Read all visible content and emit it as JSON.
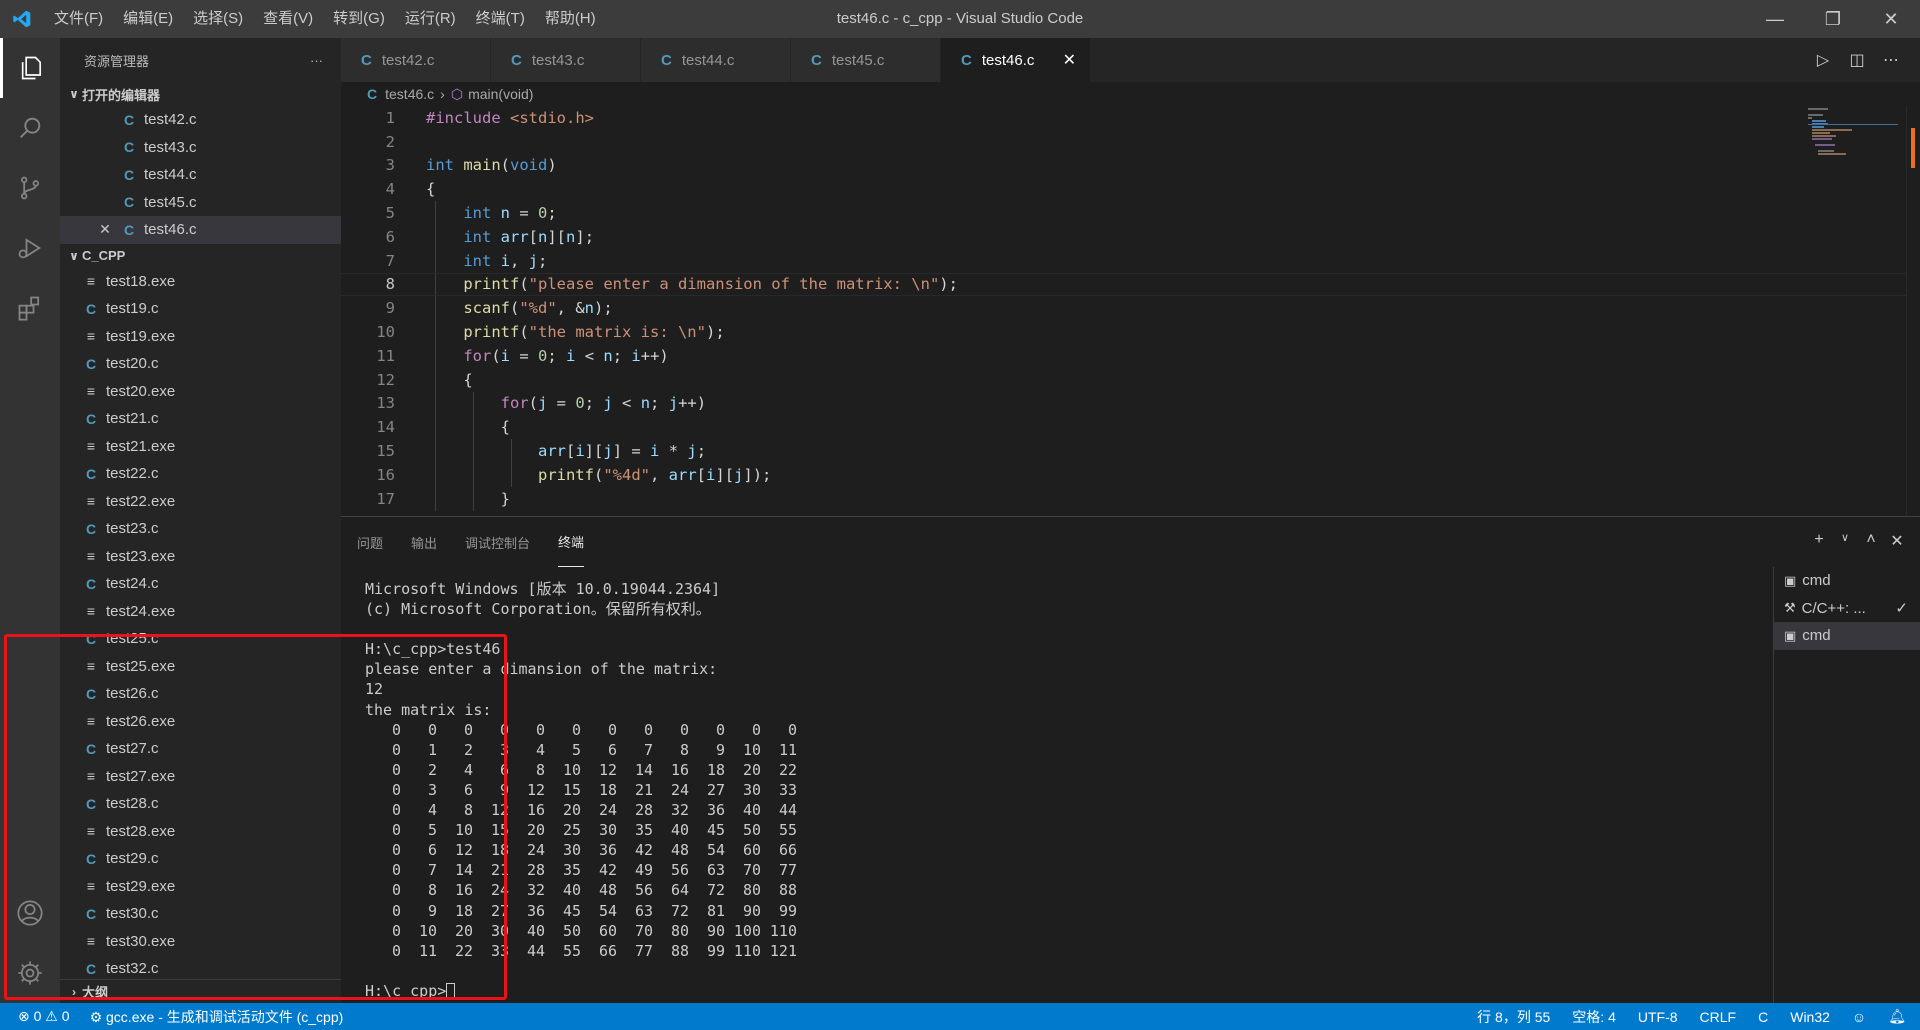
{
  "window": {
    "title": "test46.c - c_cpp - Visual Studio Code",
    "menu": [
      "文件(F)",
      "编辑(E)",
      "选择(S)",
      "查看(V)",
      "转到(G)",
      "运行(R)",
      "终端(T)",
      "帮助(H)"
    ]
  },
  "sidebar": {
    "header": "资源管理器",
    "more": "···",
    "open_editors_title": "打开的编辑器",
    "open_editors": [
      "test42.c",
      "test43.c",
      "test44.c",
      "test45.c",
      "test46.c"
    ],
    "folder_title": "C_CPP",
    "files": [
      {
        "name": "test18.exe",
        "type": "exe"
      },
      {
        "name": "test19.c",
        "type": "c"
      },
      {
        "name": "test19.exe",
        "type": "exe"
      },
      {
        "name": "test20.c",
        "type": "c"
      },
      {
        "name": "test20.exe",
        "type": "exe"
      },
      {
        "name": "test21.c",
        "type": "c"
      },
      {
        "name": "test21.exe",
        "type": "exe"
      },
      {
        "name": "test22.c",
        "type": "c"
      },
      {
        "name": "test22.exe",
        "type": "exe"
      },
      {
        "name": "test23.c",
        "type": "c"
      },
      {
        "name": "test23.exe",
        "type": "exe"
      },
      {
        "name": "test24.c",
        "type": "c"
      },
      {
        "name": "test24.exe",
        "type": "exe"
      },
      {
        "name": "test25.c",
        "type": "c"
      },
      {
        "name": "test25.exe",
        "type": "exe"
      },
      {
        "name": "test26.c",
        "type": "c"
      },
      {
        "name": "test26.exe",
        "type": "exe"
      },
      {
        "name": "test27.c",
        "type": "c"
      },
      {
        "name": "test27.exe",
        "type": "exe"
      },
      {
        "name": "test28.c",
        "type": "c"
      },
      {
        "name": "test28.exe",
        "type": "exe"
      },
      {
        "name": "test29.c",
        "type": "c"
      },
      {
        "name": "test29.exe",
        "type": "exe"
      },
      {
        "name": "test30.c",
        "type": "c"
      },
      {
        "name": "test30.exe",
        "type": "exe"
      },
      {
        "name": "test32.c",
        "type": "c"
      }
    ],
    "outline_title": "大纲"
  },
  "tabs": [
    {
      "label": "test42.c",
      "active": false
    },
    {
      "label": "test43.c",
      "active": false
    },
    {
      "label": "test44.c",
      "active": false
    },
    {
      "label": "test45.c",
      "active": false
    },
    {
      "label": "test46.c",
      "active": true
    }
  ],
  "breadcrumb": {
    "file": "test46.c",
    "symbol": "main(void)"
  },
  "editor": {
    "current_line": 8,
    "lines": [
      [
        [
          "pp",
          "#include "
        ],
        [
          "st",
          "<stdio.h>"
        ]
      ],
      [],
      [
        [
          "kw",
          "int "
        ],
        [
          "fn",
          "main"
        ],
        [
          "tx",
          "("
        ],
        [
          "kw",
          "void"
        ],
        [
          "tx",
          ")"
        ]
      ],
      [
        [
          "tx",
          "{"
        ]
      ],
      [
        [
          "tx",
          "    "
        ],
        [
          "kw",
          "int "
        ],
        [
          "va",
          "n"
        ],
        [
          "tx",
          " = "
        ],
        [
          "nm",
          "0"
        ],
        [
          "tx",
          ";"
        ]
      ],
      [
        [
          "tx",
          "    "
        ],
        [
          "kw",
          "int "
        ],
        [
          "va",
          "arr"
        ],
        [
          "tx",
          "["
        ],
        [
          "va",
          "n"
        ],
        [
          "tx",
          "]["
        ],
        [
          "va",
          "n"
        ],
        [
          "tx",
          "];"
        ]
      ],
      [
        [
          "tx",
          "    "
        ],
        [
          "kw",
          "int "
        ],
        [
          "va",
          "i"
        ],
        [
          "tx",
          ", "
        ],
        [
          "va",
          "j"
        ],
        [
          "tx",
          ";"
        ]
      ],
      [
        [
          "tx",
          "    "
        ],
        [
          "fn",
          "printf"
        ],
        [
          "tx",
          "("
        ],
        [
          "st",
          "\"please enter a dimansion of the matrix: \\n\""
        ],
        [
          "tx",
          ");"
        ]
      ],
      [
        [
          "tx",
          "    "
        ],
        [
          "fn",
          "scanf"
        ],
        [
          "tx",
          "("
        ],
        [
          "st",
          "\"%d\""
        ],
        [
          "tx",
          ", &"
        ],
        [
          "va",
          "n"
        ],
        [
          "tx",
          ");"
        ]
      ],
      [
        [
          "tx",
          "    "
        ],
        [
          "fn",
          "printf"
        ],
        [
          "tx",
          "("
        ],
        [
          "st",
          "\"the matrix is: \\n\""
        ],
        [
          "tx",
          ");"
        ]
      ],
      [
        [
          "tx",
          "    "
        ],
        [
          "pp",
          "for"
        ],
        [
          "tx",
          "("
        ],
        [
          "va",
          "i"
        ],
        [
          "tx",
          " = "
        ],
        [
          "nm",
          "0"
        ],
        [
          "tx",
          "; "
        ],
        [
          "va",
          "i"
        ],
        [
          "tx",
          " < "
        ],
        [
          "va",
          "n"
        ],
        [
          "tx",
          "; "
        ],
        [
          "va",
          "i"
        ],
        [
          "tx",
          "++)"
        ]
      ],
      [
        [
          "tx",
          "    {"
        ]
      ],
      [
        [
          "tx",
          "        "
        ],
        [
          "pp",
          "for"
        ],
        [
          "tx",
          "("
        ],
        [
          "va",
          "j"
        ],
        [
          "tx",
          " = "
        ],
        [
          "nm",
          "0"
        ],
        [
          "tx",
          "; "
        ],
        [
          "va",
          "j"
        ],
        [
          "tx",
          " < "
        ],
        [
          "va",
          "n"
        ],
        [
          "tx",
          "; "
        ],
        [
          "va",
          "j"
        ],
        [
          "tx",
          "++)"
        ]
      ],
      [
        [
          "tx",
          "        {"
        ]
      ],
      [
        [
          "tx",
          "            "
        ],
        [
          "va",
          "arr"
        ],
        [
          "tx",
          "["
        ],
        [
          "va",
          "i"
        ],
        [
          "tx",
          "]["
        ],
        [
          "va",
          "j"
        ],
        [
          "tx",
          "] = "
        ],
        [
          "va",
          "i"
        ],
        [
          "tx",
          " * "
        ],
        [
          "va",
          "j"
        ],
        [
          "tx",
          ";"
        ]
      ],
      [
        [
          "tx",
          "            "
        ],
        [
          "fn",
          "printf"
        ],
        [
          "tx",
          "("
        ],
        [
          "st",
          "\"%4d\""
        ],
        [
          "tx",
          ", "
        ],
        [
          "va",
          "arr"
        ],
        [
          "tx",
          "["
        ],
        [
          "va",
          "i"
        ],
        [
          "tx",
          "]["
        ],
        [
          "va",
          "j"
        ],
        [
          "tx",
          "]);"
        ]
      ],
      [
        [
          "tx",
          "        }"
        ]
      ]
    ]
  },
  "panel": {
    "tabs": [
      "问题",
      "输出",
      "调试控制台",
      "终端"
    ],
    "active_tab": "终端",
    "terminal": {
      "header": [
        "Microsoft Windows [版本 10.0.19044.2364]",
        "(c) Microsoft Corporation。保留所有权利。"
      ],
      "prompt_cmd": "H:\\c_cpp>test46",
      "prompt_msg": "please enter a dimansion of the matrix:",
      "input": "12",
      "result_label": "the matrix is:",
      "matrix": [
        [
          0,
          0,
          0,
          0,
          0,
          0,
          0,
          0,
          0,
          0,
          0,
          0
        ],
        [
          0,
          1,
          2,
          3,
          4,
          5,
          6,
          7,
          8,
          9,
          10,
          11
        ],
        [
          0,
          2,
          4,
          6,
          8,
          10,
          12,
          14,
          16,
          18,
          20,
          22
        ],
        [
          0,
          3,
          6,
          9,
          12,
          15,
          18,
          21,
          24,
          27,
          30,
          33
        ],
        [
          0,
          4,
          8,
          12,
          16,
          20,
          24,
          28,
          32,
          36,
          40,
          44
        ],
        [
          0,
          5,
          10,
          15,
          20,
          25,
          30,
          35,
          40,
          45,
          50,
          55
        ],
        [
          0,
          6,
          12,
          18,
          24,
          30,
          36,
          42,
          48,
          54,
          60,
          66
        ],
        [
          0,
          7,
          14,
          21,
          28,
          35,
          42,
          49,
          56,
          63,
          70,
          77
        ],
        [
          0,
          8,
          16,
          24,
          32,
          40,
          48,
          56,
          64,
          72,
          80,
          88
        ],
        [
          0,
          9,
          18,
          27,
          36,
          45,
          54,
          63,
          72,
          81,
          90,
          99
        ],
        [
          0,
          10,
          20,
          30,
          40,
          50,
          60,
          70,
          80,
          90,
          100,
          110
        ],
        [
          0,
          11,
          22,
          33,
          44,
          55,
          66,
          77,
          88,
          99,
          110,
          121
        ]
      ],
      "final_prompt": "H:\\c_cpp>"
    },
    "terminal_list": [
      {
        "label": "cmd",
        "icon": "terminal-icon",
        "selected": false
      },
      {
        "label": "C/C++: ...",
        "icon": "tools-icon",
        "selected": false,
        "check": "✓"
      },
      {
        "label": "cmd",
        "icon": "terminal-icon",
        "selected": true
      }
    ]
  },
  "statusbar": {
    "errors": "0",
    "warnings": "0",
    "task": "gcc.exe - 生成和调试活动文件 (c_cpp)",
    "position": "行 8，列 55",
    "spaces": "空格: 4",
    "encoding": "UTF-8",
    "eol": "CRLF",
    "language": "C",
    "platform": "Win32"
  },
  "colors": {
    "accent": "#007acc",
    "highlight_box": "#e8131b"
  }
}
